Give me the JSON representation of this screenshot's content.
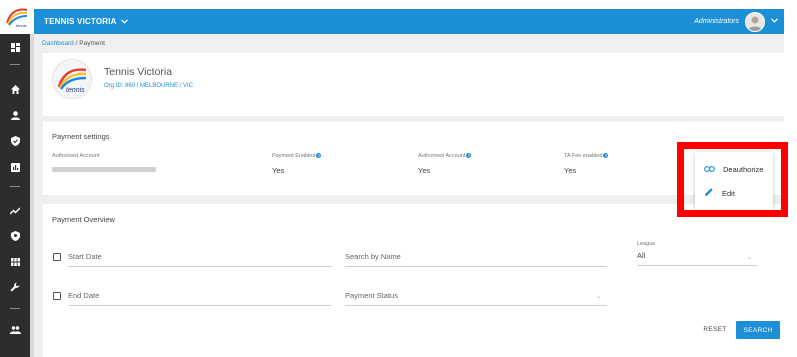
{
  "app": {
    "org_title": "TENNIS VICTORIA",
    "user_label": "Administrators",
    "accent_color": "#1c8fd6",
    "logo_text": "tennis"
  },
  "breadcrumb": {
    "parent": "Dashboard",
    "separator": "/",
    "current": "Payment"
  },
  "org": {
    "name": "Tennis Victoria",
    "meta": "Org ID: 860 / MELBOURNE / VIC",
    "logo_text": "tennis"
  },
  "payment_settings": {
    "title": "Payment settings",
    "authorised_account_label": "Authorised Account",
    "payment_enabled_label": "Payment Enabled",
    "payment_enabled_value": "Yes",
    "authorised_account_col_label": "Authorised Account",
    "authorised_account_value": "Yes",
    "ta_fee_label": "TA Fee enabled",
    "ta_fee_value": "Yes"
  },
  "menu": {
    "deauthorize": "Deauthorize",
    "edit": "Edit"
  },
  "overview": {
    "title": "Payment Overview",
    "start_date": "Start Date",
    "search_by_name": "Search by Name",
    "league_label": "League",
    "league_value": "All",
    "end_date": "End Date",
    "payment_status": "Payment Status",
    "reset": "RESET",
    "search": "SEARCH"
  },
  "sidebar": {
    "icons": [
      "dashboard-icon",
      "home-icon",
      "person-icon",
      "shield-check-icon",
      "bar-chart-icon",
      "trending-icon",
      "shield-icon",
      "grid-icon",
      "wrench-icon",
      "group-icon"
    ]
  }
}
